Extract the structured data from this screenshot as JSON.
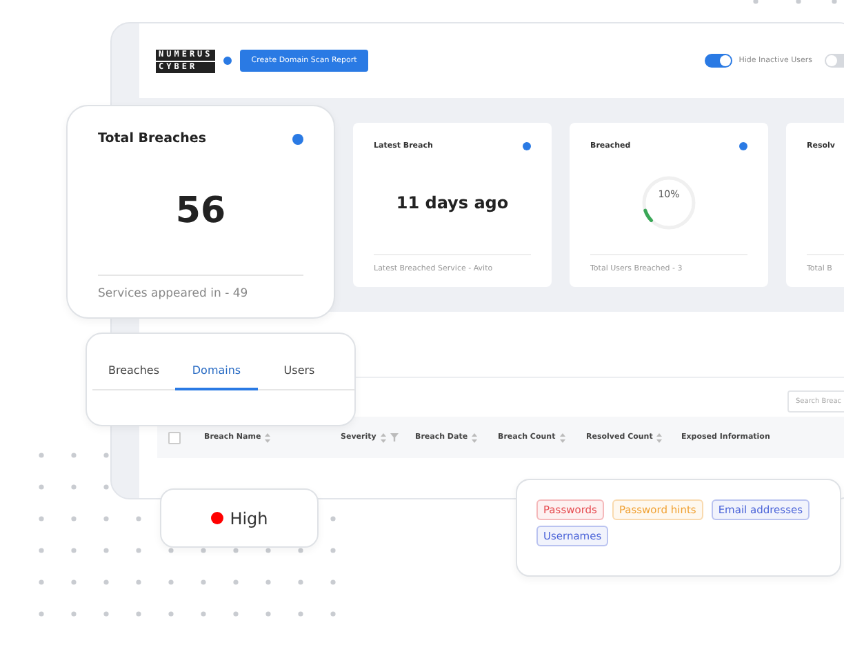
{
  "header": {
    "logo": [
      "NUMERUS",
      "CYBER"
    ],
    "button": "Create Domain Scan Report",
    "toggles": [
      {
        "label": "Hide Inactive Users",
        "on": true
      },
      {
        "on": false
      }
    ]
  },
  "stats": [
    {
      "kind": "value",
      "title": "Latest Breach",
      "info": true,
      "value": "11 days ago",
      "footer": "Latest Breached Service - Avito"
    },
    {
      "kind": "gauge",
      "title": "Breached",
      "info": true,
      "reading": "10%",
      "level": 0.1,
      "footer": "Total Users Breached - 3"
    },
    {
      "kind": "value",
      "title": "Resolv",
      "footer": "Total B"
    }
  ],
  "search": {
    "placeholder": "Search Breac"
  },
  "table": {
    "select_all": {
      "checked": false
    },
    "columns": [
      {
        "label": "Breach Name",
        "sortable": true,
        "filter": false
      },
      {
        "label": "Severity",
        "sortable": true,
        "filter": true
      },
      {
        "label": "Breach Date",
        "sortable": true,
        "filter": false
      },
      {
        "label": "Breach Count",
        "sortable": true,
        "filter": false
      },
      {
        "label": "Resolved Count",
        "sortable": true,
        "filter": false
      },
      {
        "label": "Exposed Information",
        "sortable": false,
        "filter": false
      }
    ]
  },
  "highlight_card": {
    "title": "Total Breaches",
    "value": "56",
    "footer": "Services appeared in - 49"
  },
  "tabs": [
    {
      "label": "Breaches",
      "selected": false
    },
    {
      "label": "Domains",
      "selected": true
    },
    {
      "label": "Users",
      "selected": false
    }
  ],
  "severity_card": {
    "label": "High",
    "color": "#ff0000"
  },
  "exposed_card": {
    "tags": [
      {
        "label": "Passwords",
        "color": "#e5484d"
      },
      {
        "label": "Password hints",
        "color": "#f0a030"
      },
      {
        "label": "Email addresses",
        "color": "#4a63d8"
      },
      {
        "label": "Usernames",
        "color": "#4a63d8"
      }
    ]
  }
}
